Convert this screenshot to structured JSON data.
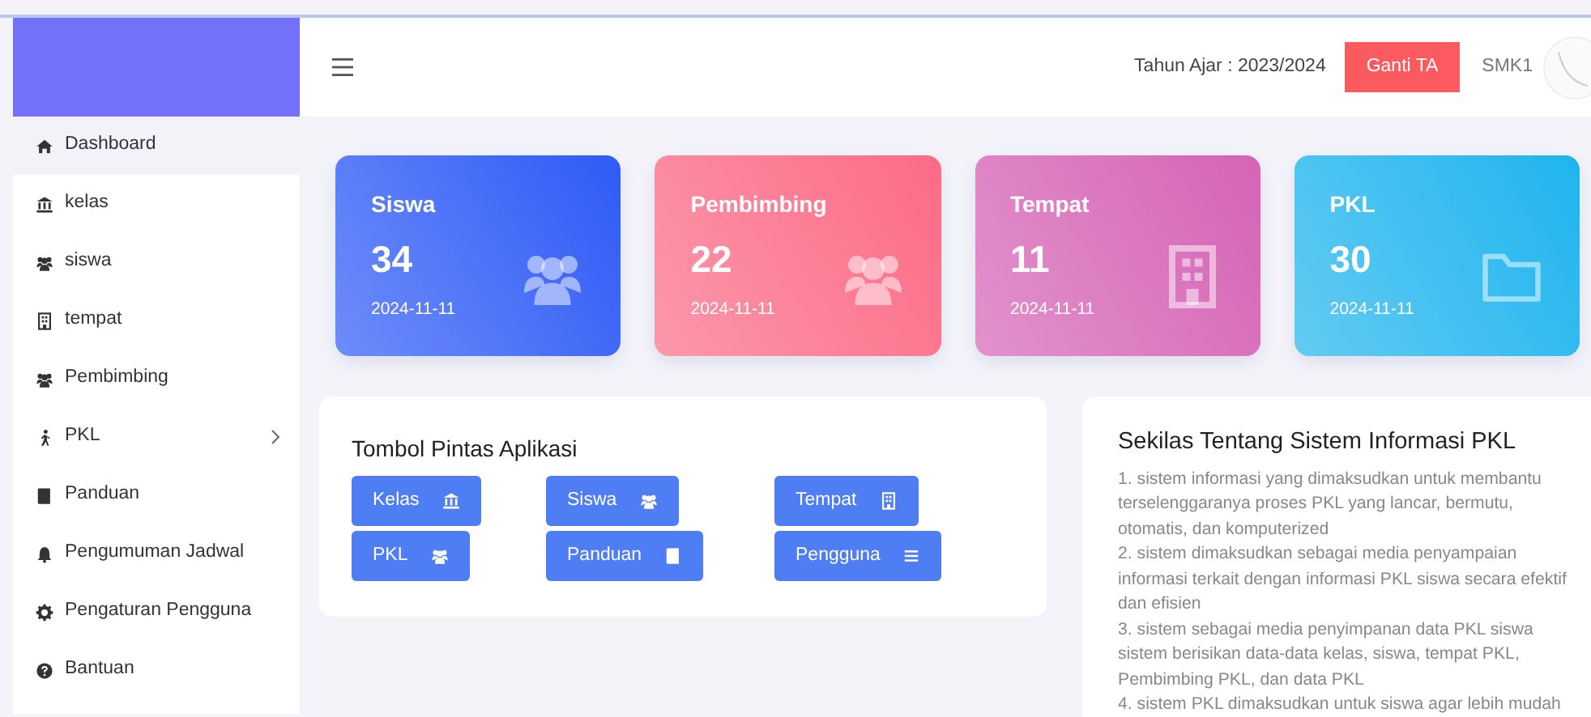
{
  "topbar": {
    "year_label": "Tahun Ajar : 2023/2024",
    "change_button": "Ganti TA",
    "school": "SMK1"
  },
  "sidebar": {
    "items": [
      {
        "label": "Dashboard",
        "selected": true
      },
      {
        "label": "kelas",
        "selected": false
      },
      {
        "label": "siswa",
        "selected": false
      },
      {
        "label": "tempat",
        "selected": false
      },
      {
        "label": "Pembimbing",
        "selected": false
      },
      {
        "label": "PKL",
        "selected": false,
        "has_submenu": true
      },
      {
        "label": "Panduan",
        "selected": false
      },
      {
        "label": "Pengumuman Jadwal",
        "selected": false
      },
      {
        "label": "Pengaturan Pengguna",
        "selected": false
      },
      {
        "label": "Bantuan",
        "selected": false
      }
    ]
  },
  "stats": [
    {
      "title": "Siswa",
      "value": "34",
      "date": "2024-11-11",
      "color": "#2f5bf6"
    },
    {
      "title": "Pembimbing",
      "value": "22",
      "date": "2024-11-11",
      "color": "#fb6b86"
    },
    {
      "title": "Tempat",
      "value": "11",
      "date": "2024-11-11",
      "color": "#d563b6"
    },
    {
      "title": "PKL",
      "value": "30",
      "date": "2024-11-11",
      "color": "#1fb4ee"
    }
  ],
  "shortcuts": {
    "title": "Tombol Pintas Aplikasi",
    "buttons": [
      {
        "label": "Kelas"
      },
      {
        "label": "Siswa"
      },
      {
        "label": "Tempat"
      },
      {
        "label": "PKL"
      },
      {
        "label": "Panduan"
      },
      {
        "label": "Pengguna"
      }
    ]
  },
  "about": {
    "title": "Sekilas Tentang Sistem Informasi PKL",
    "points": [
      "1. sistem informasi yang dimaksudkan untuk membantu terselenggaranya proses PKL yang lancar, bermutu, otomatis, dan komputerized",
      "2. sistem dimaksudkan sebagai media penyampaian informasi terkait dengan informasi PKL siswa secara efektif dan efisien",
      "3. sistem sebagai media penyimpanan data PKL siswa sistem berisikan data-data kelas, siswa, tempat PKL, Pembimbing PKL, dan data PKL",
      "4. sistem PKL dimaksudkan untuk siswa agar lebih mudah"
    ]
  }
}
